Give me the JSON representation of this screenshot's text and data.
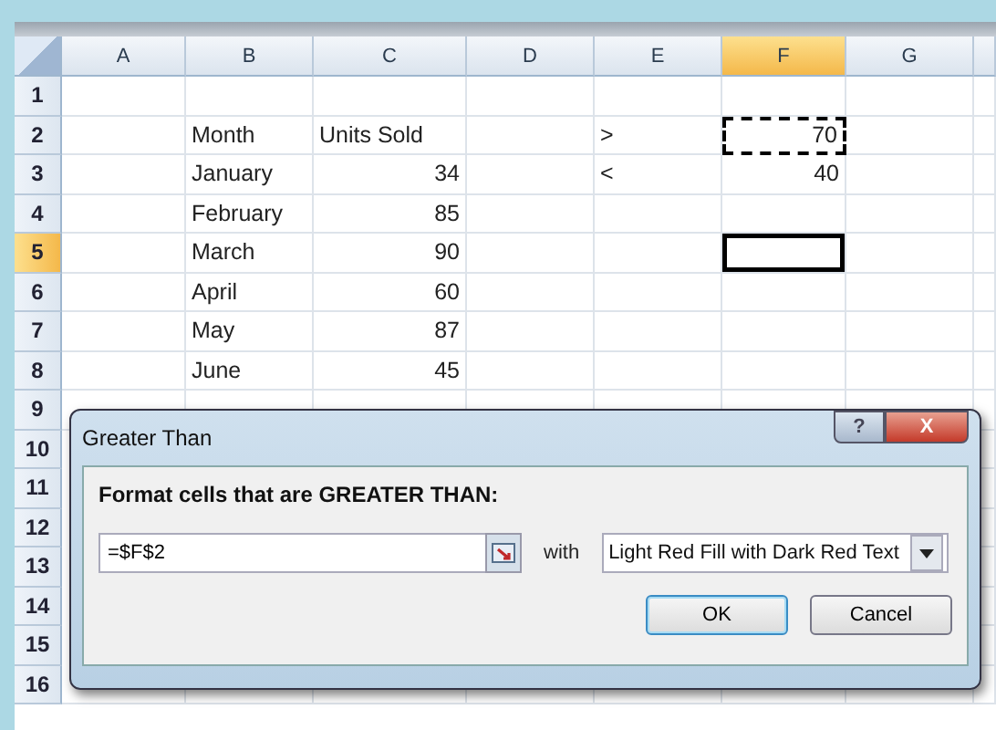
{
  "columns": [
    {
      "label": "A",
      "selected": false
    },
    {
      "label": "B",
      "selected": false
    },
    {
      "label": "C",
      "selected": false
    },
    {
      "label": "D",
      "selected": false
    },
    {
      "label": "E",
      "selected": false
    },
    {
      "label": "F",
      "selected": true
    },
    {
      "label": "G",
      "selected": false
    }
  ],
  "rows": [
    {
      "label": "1",
      "selected": false
    },
    {
      "label": "2",
      "selected": false,
      "cells": [
        {
          "kind": "empty",
          "selected": false
        },
        {
          "kind": "text",
          "text": "Month",
          "selected": false
        },
        {
          "kind": "text",
          "text": "Units Sold",
          "selected": false
        },
        {
          "kind": "empty",
          "selected": false
        },
        {
          "kind": "text",
          "text": ">",
          "selected": false
        },
        {
          "kind": "number",
          "text": "70",
          "selected": false,
          "marquee": true
        },
        {
          "kind": "empty",
          "selected": false
        }
      ]
    },
    {
      "label": "3",
      "selected": false,
      "cells": [
        {
          "kind": "empty",
          "selected": false
        },
        {
          "kind": "text",
          "text": "January",
          "selected": false
        },
        {
          "kind": "number",
          "text": "34",
          "selected": false
        },
        {
          "kind": "empty",
          "selected": false
        },
        {
          "kind": "text",
          "text": "<",
          "selected": false
        },
        {
          "kind": "number",
          "text": "40",
          "selected": false
        },
        {
          "kind": "empty",
          "selected": false
        }
      ]
    },
    {
      "label": "4",
      "selected": false,
      "cells": [
        {
          "kind": "empty",
          "selected": false
        },
        {
          "kind": "text",
          "text": "February",
          "selected": false
        },
        {
          "kind": "number",
          "text": "85",
          "selected": false
        },
        {
          "kind": "empty",
          "selected": false
        },
        {
          "kind": "empty",
          "selected": false
        },
        {
          "kind": "empty",
          "selected": false
        },
        {
          "kind": "empty",
          "selected": false
        }
      ]
    },
    {
      "label": "5",
      "selected": true,
      "cells": [
        {
          "kind": "empty",
          "selected": false
        },
        {
          "kind": "text",
          "text": "March",
          "selected": false
        },
        {
          "kind": "number",
          "text": "90",
          "selected": false
        },
        {
          "kind": "empty",
          "selected": false
        },
        {
          "kind": "empty",
          "selected": false
        },
        {
          "kind": "empty",
          "selected": true
        },
        {
          "kind": "empty",
          "selected": false
        }
      ]
    },
    {
      "label": "6",
      "selected": false,
      "cells": [
        {
          "kind": "empty",
          "selected": false
        },
        {
          "kind": "text",
          "text": "April",
          "selected": false
        },
        {
          "kind": "number",
          "text": "60",
          "selected": false
        },
        {
          "kind": "empty",
          "selected": false
        },
        {
          "kind": "empty",
          "selected": false
        },
        {
          "kind": "empty",
          "selected": false
        },
        {
          "kind": "empty",
          "selected": false
        }
      ]
    },
    {
      "label": "7",
      "selected": false,
      "cells": [
        {
          "kind": "empty",
          "selected": false
        },
        {
          "kind": "text",
          "text": "May",
          "selected": false
        },
        {
          "kind": "number",
          "text": "87",
          "selected": false
        },
        {
          "kind": "empty",
          "selected": false
        },
        {
          "kind": "empty",
          "selected": false
        },
        {
          "kind": "empty",
          "selected": false
        },
        {
          "kind": "empty",
          "selected": false
        }
      ]
    },
    {
      "label": "8",
      "selected": false,
      "cells": [
        {
          "kind": "empty",
          "selected": false
        },
        {
          "kind": "text",
          "text": "June",
          "selected": false
        },
        {
          "kind": "number",
          "text": "45",
          "selected": false
        },
        {
          "kind": "empty",
          "selected": false
        },
        {
          "kind": "empty",
          "selected": false
        },
        {
          "kind": "empty",
          "selected": false
        },
        {
          "kind": "empty",
          "selected": false
        }
      ]
    },
    {
      "label": "9",
      "selected": false
    },
    {
      "label": "10",
      "selected": false
    },
    {
      "label": "11",
      "selected": false
    },
    {
      "label": "12",
      "selected": false
    },
    {
      "label": "13",
      "selected": false
    },
    {
      "label": "14",
      "selected": false
    },
    {
      "label": "15",
      "selected": false
    },
    {
      "label": "16",
      "selected": false
    }
  ],
  "dialog": {
    "title": "Greater Than",
    "help_button": "?",
    "close_button": "X",
    "prompt": "Format cells that are GREATER THAN:",
    "value": "=$F$2",
    "with_label": "with",
    "format": "Light Red Fill with Dark Red Text",
    "buttons": [
      {
        "label": "OK",
        "default": true
      },
      {
        "label": "Cancel",
        "default": false
      }
    ]
  }
}
